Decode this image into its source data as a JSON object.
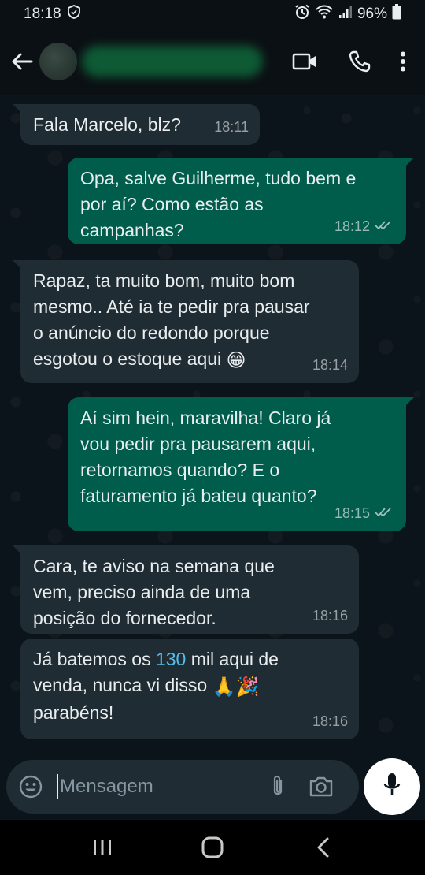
{
  "status_bar": {
    "time": "18:18",
    "battery": "96%"
  },
  "header": {
    "icons": [
      "back-arrow-icon",
      "avatar",
      "video-call-icon",
      "voice-call-icon",
      "menu-icon"
    ]
  },
  "messages": [
    {
      "direction": "in",
      "text": "Fala Marcelo, blz?",
      "time": "18:11"
    },
    {
      "direction": "out",
      "text": "Opa, salve Guilherme, tudo bem e\npor aí? Como estão as\ncampanhas?",
      "time": "18:12"
    },
    {
      "direction": "in",
      "text": "Rapaz, ta muito bom, muito bom\nmesmo.. Até ia te pedir pra pausar\no anúncio do redondo porque\nesgotou o estoque aqui",
      "emoji": "😁",
      "time": "18:14"
    },
    {
      "direction": "out",
      "text": "Aí sim hein, maravilha! Claro já\nvou pedir pra pausarem aqui,\nretornamos quando? E o\nfaturamento já bateu quanto?",
      "time": "18:15"
    },
    {
      "direction": "in",
      "text": "Cara, te aviso na semana que\nvem, preciso ainda de uma\nposição do fornecedor.",
      "time": "18:16"
    },
    {
      "direction": "in",
      "text_before": "Já batemos os ",
      "highlight": "130",
      "text_after": " mil aqui de\nvenda, nunca vi disso ",
      "emoji": "🙏🎉",
      "text_end": "\nparabéns!",
      "time": "18:16"
    }
  ],
  "composer": {
    "placeholder": "Mensagem"
  },
  "colors": {
    "incoming_bubble": "#202c33",
    "outgoing_bubble": "#005c4b",
    "link_highlight": "#53bdeb",
    "background": "#0b141a"
  }
}
